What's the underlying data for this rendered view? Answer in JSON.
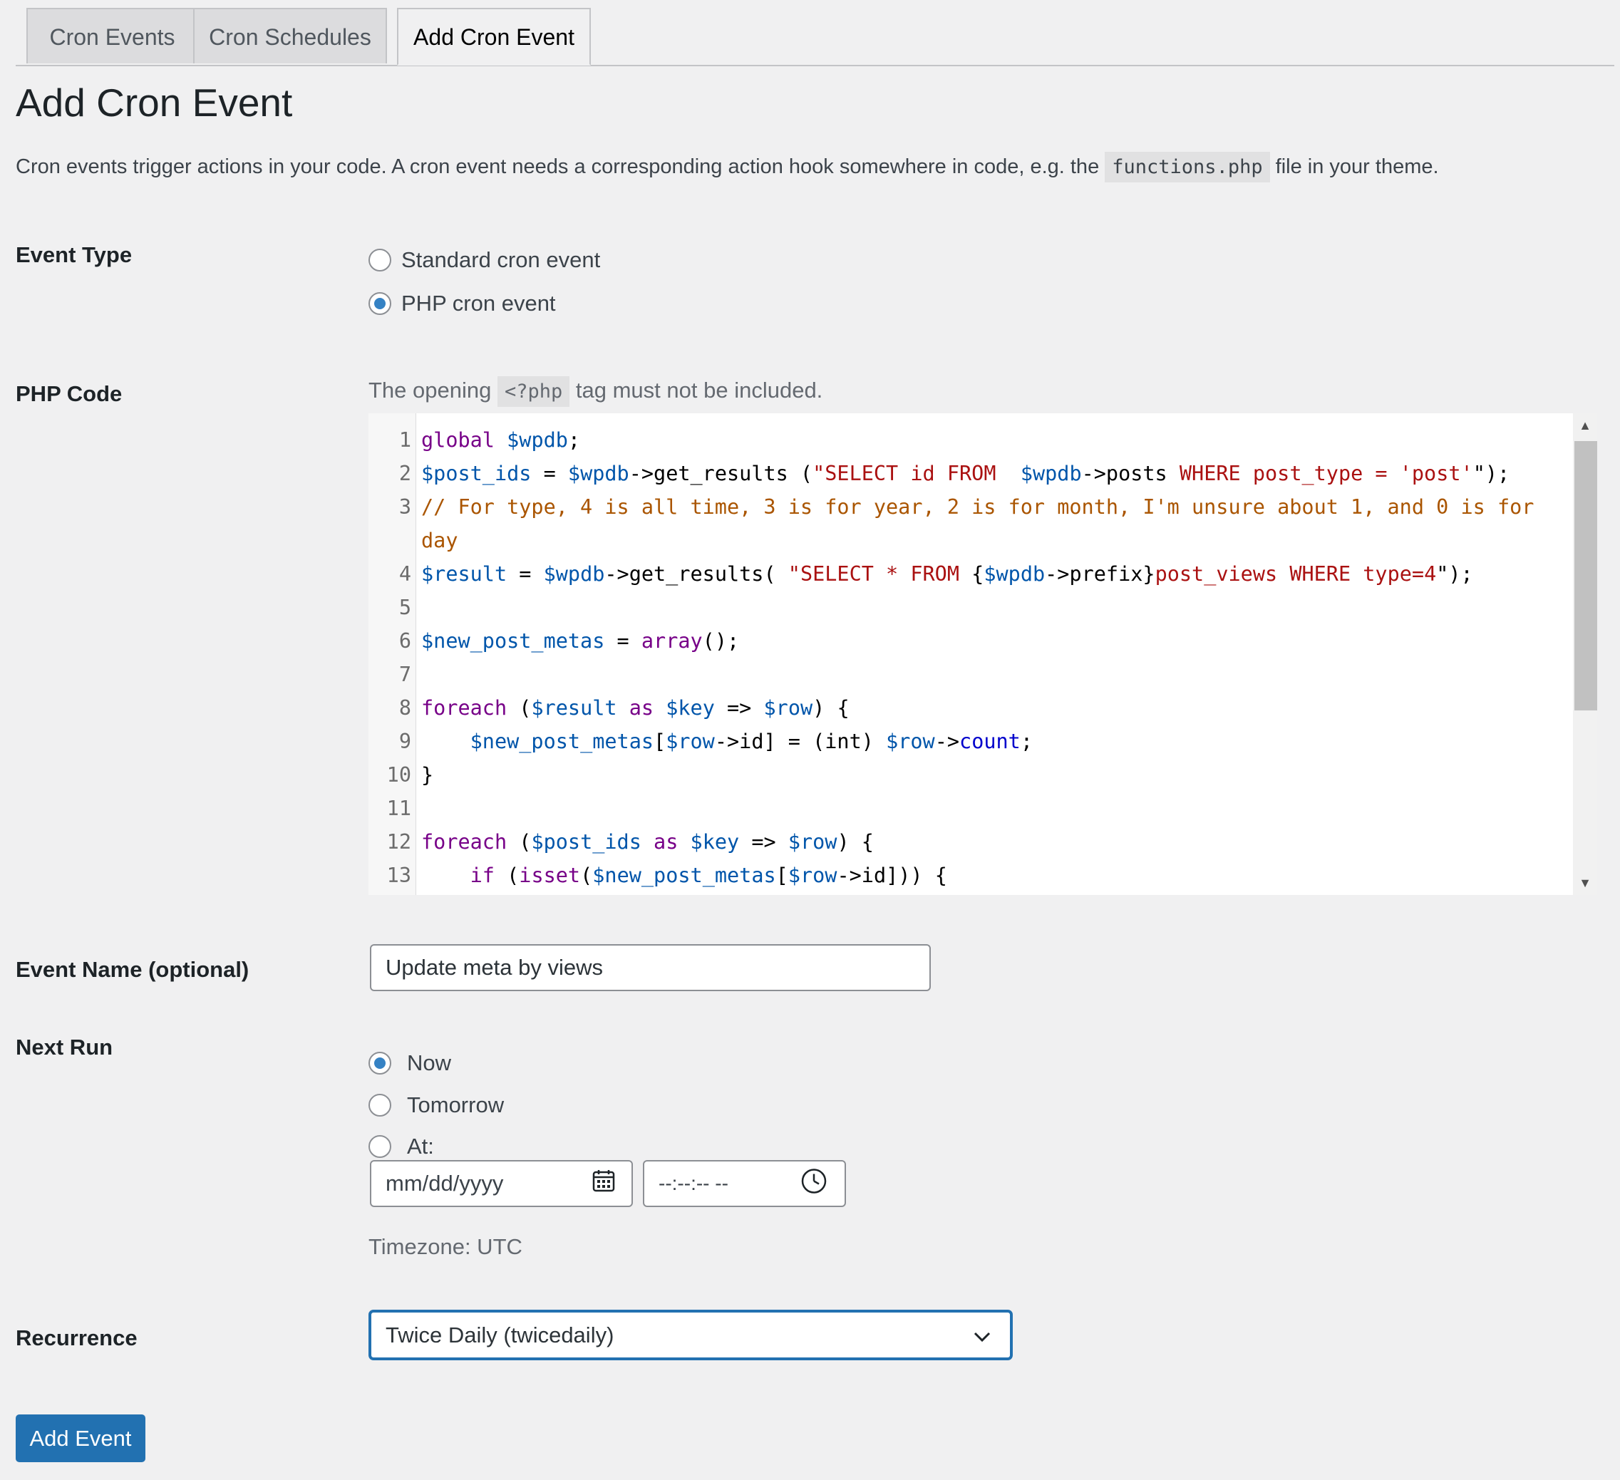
{
  "tabs": [
    {
      "label": "Cron Events",
      "active": false
    },
    {
      "label": "Cron Schedules",
      "active": false
    },
    {
      "label": "Add Cron Event",
      "active": true
    }
  ],
  "page": {
    "title": "Add Cron Event",
    "intro_before": "Cron events trigger actions in your code. A cron event needs a corresponding action hook somewhere in code, e.g. the",
    "intro_code": "functions.php",
    "intro_after": "file in your theme."
  },
  "event_type": {
    "label": "Event Type",
    "options": [
      "Standard cron event",
      "PHP cron event"
    ],
    "selected": "PHP cron event"
  },
  "php_code": {
    "label": "PHP Code",
    "desc_before": "The opening",
    "desc_code": "<?php",
    "desc_after": "tag must not be included.",
    "line_numbers": [
      "1",
      "2",
      "3",
      "",
      "4",
      "5",
      "6",
      "7",
      "8",
      "9",
      "10",
      "11",
      "12",
      "13"
    ]
  },
  "event_name": {
    "label": "Event Name (optional)",
    "value": "Update meta by views"
  },
  "next_run": {
    "label": "Next Run",
    "options": [
      "Now",
      "Tomorrow",
      "At:"
    ],
    "selected": "Now",
    "date_placeholder": "mm/dd/yyyy",
    "time_placeholder": "--:--:-- --",
    "timezone": "Timezone: UTC"
  },
  "recurrence": {
    "label": "Recurrence",
    "selected": "Twice Daily (twicedaily)"
  },
  "submit": {
    "label": "Add Event"
  },
  "icons": {
    "date": "calendar-icon",
    "time": "clock-icon",
    "select": "chevron-down-icon"
  },
  "colors": {
    "primary": "#2271b1",
    "radio_checked": "#3582c4"
  }
}
